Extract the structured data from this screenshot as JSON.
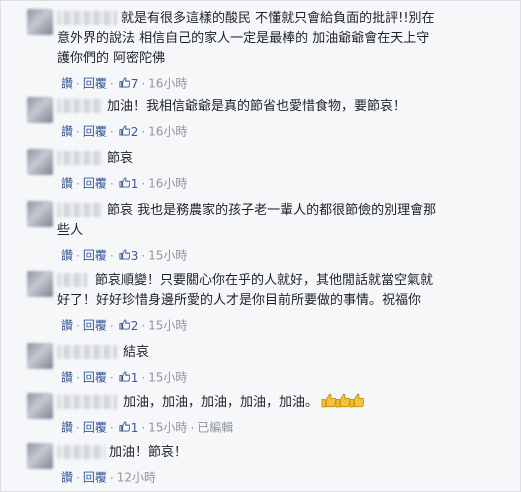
{
  "comments": [
    {
      "lines": [
        "就是有很多這樣的酸民 不懂就只會給負面的批評!!別在",
        "意外界的說法 相信自己的家人一定是最棒的 加油爺爺會在天上守",
        "護你們的 阿密陀佛"
      ],
      "like": "讚",
      "reply": "回覆",
      "likes": "7",
      "time": "16小時"
    },
    {
      "lines": [
        "加油！我相信爺爺是真的節省也愛惜食物，要節哀！"
      ],
      "like": "讚",
      "reply": "回覆",
      "likes": "2",
      "time": "16小時"
    },
    {
      "lines": [
        "節哀"
      ],
      "like": "讚",
      "reply": "回覆",
      "likes": "1",
      "time": "16小時"
    },
    {
      "lines": [
        "節哀 我也是務農家的孩子老一輩人的都很節儉的別理會那",
        "些人"
      ],
      "like": "讚",
      "reply": "回覆",
      "likes": "3",
      "time": "15小時"
    },
    {
      "lines": [
        "節哀順變！只要關心你在乎的人就好，其他閒話就當空氣就",
        "好了！好好珍惜身邊所愛的人才是你目前所要做的事情。祝福你"
      ],
      "like": "讚",
      "reply": "回覆",
      "likes": "2",
      "time": "15小時"
    },
    {
      "lines": [
        "結哀"
      ],
      "like": "讚",
      "reply": "回覆",
      "likes": "1",
      "time": "15小時"
    },
    {
      "lines": [
        "加油，加油，加油，加油，加油。"
      ],
      "like": "讚",
      "reply": "回覆",
      "likes": "1",
      "time": "15小時",
      "edited": "已編輯"
    },
    {
      "lines": [
        "加油！節哀！"
      ],
      "like": "讚",
      "reply": "回覆",
      "time": "12小時"
    }
  ],
  "colors": {
    "link": "#365899",
    "text": "#1d2129",
    "meta": "#90949c",
    "background": "#f6f7f9"
  },
  "icons": {
    "like": "thumbs-up-icon"
  }
}
